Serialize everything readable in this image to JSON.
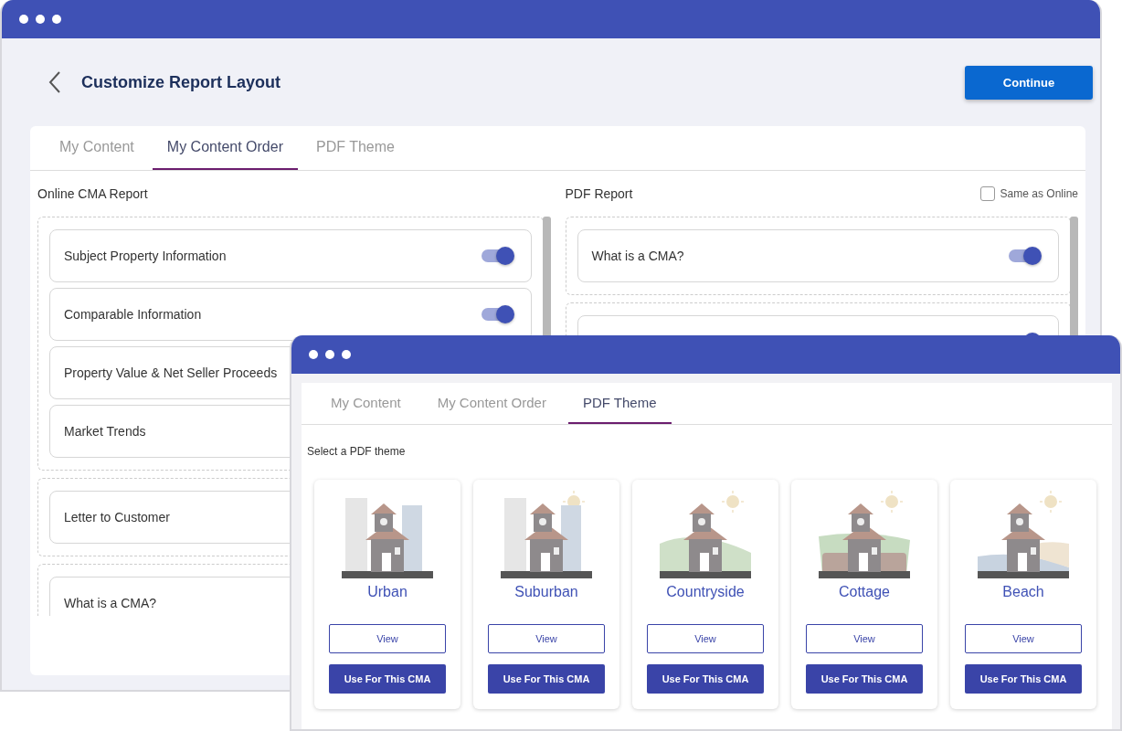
{
  "window_back": {
    "title": "Customize Report Layout",
    "continue_button": "Continue",
    "tabs": [
      {
        "label": "My Content",
        "selected": false
      },
      {
        "label": "My Content Order",
        "selected": true
      },
      {
        "label": "PDF Theme",
        "selected": false
      }
    ],
    "online_report": {
      "title": "Online CMA Report",
      "groups": [
        {
          "items": [
            {
              "label": "Subject Property Information",
              "on": true
            },
            {
              "label": "Comparable Information",
              "on": true
            },
            {
              "label": "Property Value & Net Seller Proceeds"
            },
            {
              "label": "Market Trends"
            }
          ]
        },
        {
          "items": [
            {
              "label": "Letter to Customer"
            }
          ]
        },
        {
          "items": [
            {
              "label": "What is a CMA?"
            }
          ]
        }
      ]
    },
    "pdf_report": {
      "title": "PDF Report",
      "same_as_online": {
        "label": "Same as Online",
        "checked": false
      },
      "groups": [
        {
          "items": [
            {
              "label": "What is a CMA?",
              "on": true
            }
          ]
        },
        {
          "items": [
            {
              "on": true
            }
          ]
        }
      ]
    }
  },
  "window_front": {
    "tabs": [
      {
        "label": "My Content",
        "selected": false
      },
      {
        "label": "My Content Order",
        "selected": false
      },
      {
        "label": "PDF Theme",
        "selected": true
      }
    ],
    "heading": "Select a PDF theme",
    "themes": [
      {
        "name": "Urban",
        "view_button": "View",
        "use_button": "Use For This CMA"
      },
      {
        "name": "Suburban",
        "view_button": "View",
        "use_button": "Use For This CMA"
      },
      {
        "name": "Countryside",
        "view_button": "View",
        "use_button": "Use For This CMA"
      },
      {
        "name": "Cottage",
        "view_button": "View",
        "use_button": "Use For This CMA"
      },
      {
        "name": "Beach",
        "view_button": "View",
        "use_button": "Use For This CMA"
      }
    ]
  }
}
